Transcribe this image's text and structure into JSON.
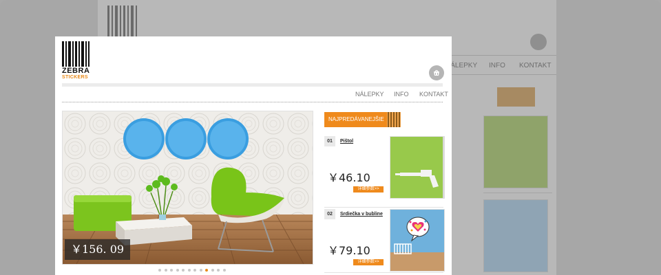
{
  "site": {
    "logo_line1": "ZEBRA",
    "logo_line2": "STICKERS"
  },
  "nav": {
    "items": [
      "NÁLEPKY",
      "INFO",
      "KONTAKT"
    ]
  },
  "background_nav": {
    "items": [
      "NÁLEPKY",
      "INFO",
      "KONTAKT"
    ]
  },
  "slider": {
    "price": "￥156. 09",
    "dot_count": 12,
    "active_index": 8
  },
  "bestsellers": {
    "title": "NAJPREDÁVANEJŠIE",
    "items": [
      {
        "num": "01",
        "name": "Pištol",
        "price": "￥46.10",
        "detail": "详细参数>>"
      },
      {
        "num": "02",
        "name": "Srdiečka v bubline",
        "price": "￥79.10",
        "detail": "详细参数>>"
      }
    ]
  },
  "colors": {
    "accent": "#ef8a1c",
    "overlay": "#a7a7a7"
  },
  "icons": {
    "cart": "cart-icon"
  }
}
